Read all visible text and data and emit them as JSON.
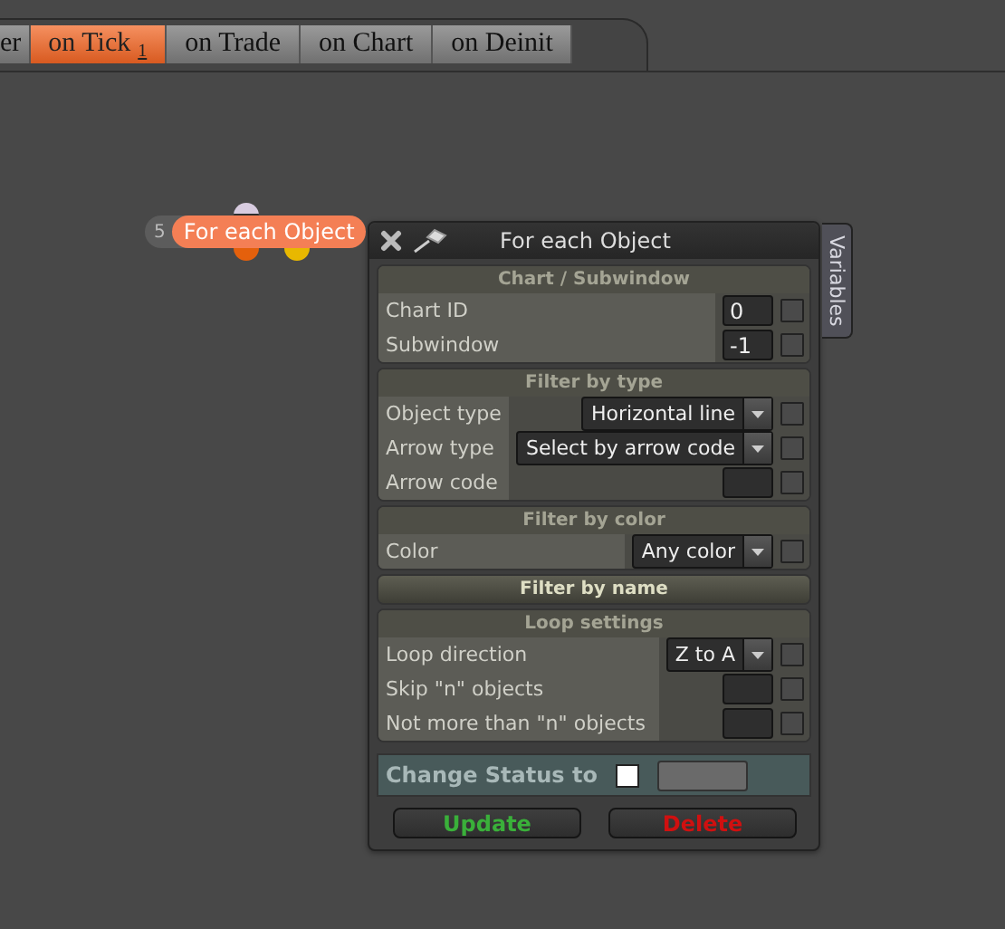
{
  "tabs": [
    {
      "label": "er",
      "selected": false
    },
    {
      "label": "on Tick",
      "badge": "1",
      "selected": true
    },
    {
      "label": "on Trade",
      "selected": false
    },
    {
      "label": "on Chart",
      "selected": false
    },
    {
      "label": "on Deinit",
      "selected": false
    }
  ],
  "node": {
    "number": "5",
    "title": "For each Object"
  },
  "dialog": {
    "title": "For each Object",
    "side_tab": "Variables",
    "sections": [
      {
        "title": "Chart / Subwindow",
        "expanded": true,
        "rows": [
          {
            "kind": "number",
            "label": "Chart ID",
            "value": "0",
            "checked": false
          },
          {
            "kind": "number",
            "label": "Subwindow",
            "value": "-1",
            "checked": false
          }
        ]
      },
      {
        "title": "Filter by type",
        "expanded": true,
        "rows": [
          {
            "kind": "dropdown",
            "label": "Object type",
            "value": "Horizontal line",
            "checked": false
          },
          {
            "kind": "dropdown",
            "label": "Arrow type",
            "value": "Select by arrow code",
            "checked": false
          },
          {
            "kind": "number",
            "label": "Arrow code",
            "checked": false
          }
        ]
      },
      {
        "title": "Filter by color",
        "expanded": true,
        "rows": [
          {
            "kind": "dropdown",
            "label": "Color",
            "value": "Any color",
            "checked": false
          }
        ]
      },
      {
        "title": "Filter by name",
        "expanded": false
      },
      {
        "title": "Loop settings",
        "expanded": true,
        "rows": [
          {
            "kind": "dropdown",
            "label": "Loop direction",
            "value": "Z to A",
            "checked": false
          },
          {
            "kind": "number",
            "label": "Skip \"n\" objects",
            "checked": false
          },
          {
            "kind": "number",
            "label": "Not more than \"n\" objects",
            "checked": false
          }
        ]
      }
    ],
    "status": {
      "label": "Change Status to",
      "checked": false
    },
    "buttons": [
      {
        "label": "Update",
        "kind": "update"
      },
      {
        "label": "Delete",
        "kind": "delete"
      }
    ]
  }
}
